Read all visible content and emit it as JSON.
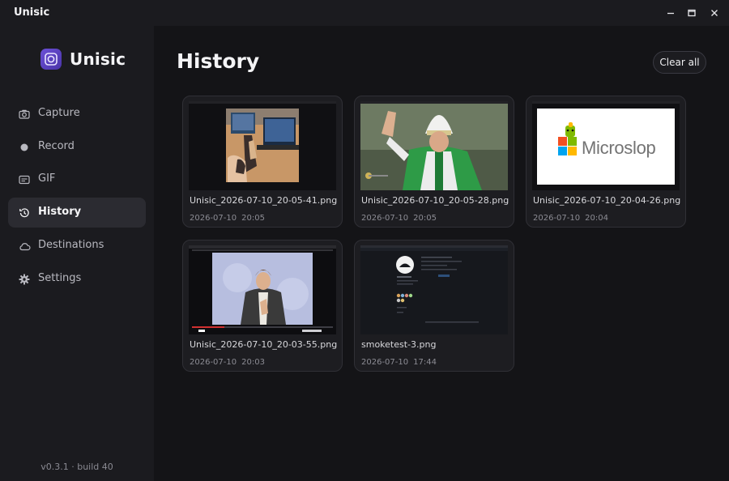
{
  "window": {
    "title": "Unisic",
    "controls": [
      "minimize-icon",
      "maximize-icon",
      "close-icon"
    ]
  },
  "sidebar": {
    "brand": "Unisic",
    "items": [
      {
        "label": "Capture",
        "icon": "camera-icon"
      },
      {
        "label": "Record",
        "icon": "record-dot-icon"
      },
      {
        "label": "GIF",
        "icon": "gif-icon"
      },
      {
        "label": "History",
        "icon": "history-icon",
        "active": true
      },
      {
        "label": "Destinations",
        "icon": "cloud-icon"
      },
      {
        "label": "Settings",
        "icon": "gear-icon"
      }
    ],
    "version": "v0.3.1 · build 40"
  },
  "main": {
    "title": "History",
    "clear_all": "Clear all",
    "items": [
      {
        "name": "Unisic_2026-07-10_20-05-41.png",
        "date": "2026-07-10",
        "time": "20:05"
      },
      {
        "name": "Unisic_2026-07-10_20-05-28.png",
        "date": "2026-07-10",
        "time": "20:05"
      },
      {
        "name": "Unisic_2026-07-10_20-04-26.png",
        "date": "2026-07-10",
        "time": "20:04",
        "thumb_text": "Microslop"
      },
      {
        "name": "Unisic_2026-07-10_20-03-55.png",
        "date": "2026-07-10",
        "time": "20:03"
      },
      {
        "name": "smoketest-3.png",
        "date": "2026-07-10",
        "time": "17:44"
      }
    ]
  },
  "colors": {
    "background": "#141417",
    "sidebar": "#1b1b1f",
    "active_item": "#2b2b31",
    "brand_accent": "#6b4fd6",
    "card": "#1d1d21"
  }
}
